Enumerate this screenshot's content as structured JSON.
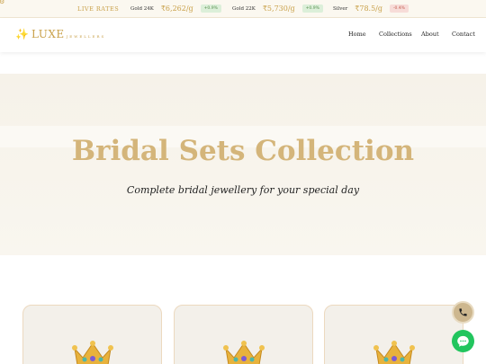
{
  "ticker": {
    "live_label": "LIVE RATES",
    "rates": [
      {
        "label": "Gold 24K",
        "value": "₹6,262/g",
        "change": "+0.9%",
        "direction": "up"
      },
      {
        "label": "Gold 22K",
        "value": "₹5,730/g",
        "change": "+0.9%",
        "direction": "up"
      },
      {
        "label": "Silver",
        "value": "₹78.5/g",
        "change": "-0.4%",
        "direction": "down"
      }
    ]
  },
  "header": {
    "brand": "LUXE",
    "brand_sub": "JEWELLERS",
    "nav": [
      "Home",
      "Collections",
      "About",
      "Contact"
    ]
  },
  "hero": {
    "title": "Bridal Sets Collection",
    "subtitle": "Complete bridal jewellery for your special day"
  },
  "cards": [
    {
      "icon": "crown-icon"
    },
    {
      "icon": "crown-icon"
    },
    {
      "icon": "crown-icon"
    }
  ],
  "colors": {
    "gold": "#c9a14a",
    "title_gold": "#d4b57a",
    "chat_green": "#22c55e",
    "call_tan": "#cdb78f"
  },
  "floating": {
    "call_icon": "phone-icon",
    "chat_icon": "chat-icon"
  }
}
